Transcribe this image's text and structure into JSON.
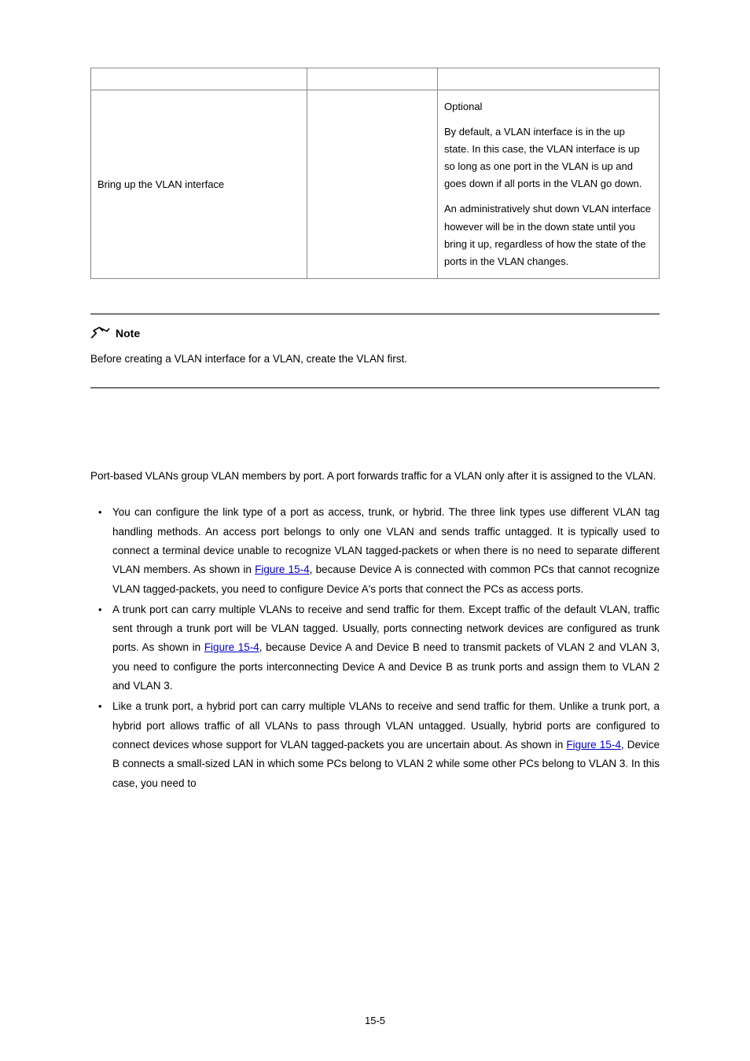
{
  "table": {
    "row1": {
      "c1": "Bring up the VLAN interface",
      "c2": "",
      "p1": "Optional",
      "p2": "By default, a VLAN interface is in the up state. In this case, the VLAN interface is up so long as one port in the VLAN is up and goes down if all ports in the VLAN go down.",
      "p3": "An administratively shut down VLAN interface however will be in the down state until you bring it up, regardless of how the state of the ports in the VLAN changes."
    }
  },
  "note": {
    "label": "Note",
    "text": "Before creating a VLAN interface for a VLAN, create the VLAN first."
  },
  "intro": "Port-based VLANs group VLAN members by port. A port forwards traffic for a VLAN only after it is assigned to the VLAN.",
  "b1a": "You can configure the link type of a port as access, trunk, or hybrid. The three link types use different VLAN tag handling methods. An access port belongs to only one VLAN and sends traffic untagged. It is typically used to connect a terminal device unable to recognize VLAN tagged-packets or when there is no need to separate different VLAN members. As shown in ",
  "b1link": "Figure 15-4",
  "b1b": ", because Device A is connected with common PCs that cannot recognize VLAN tagged-packets, you need to configure Device A's ports that connect the PCs as access ports.",
  "b2a": "A trunk port can carry multiple VLANs to receive and send traffic for them. Except traffic of the default VLAN, traffic sent through a trunk port will be VLAN tagged. Usually, ports connecting network devices are configured as trunk ports. As shown in ",
  "b2link": "Figure 15-4",
  "b2b": ", because Device A and Device B need to transmit packets of VLAN 2 and VLAN 3, you need to configure the ports interconnecting Device A and Device B as trunk ports and assign them to VLAN 2 and VLAN 3.",
  "b3a": "Like a trunk port, a hybrid port can carry multiple VLANs to receive and send traffic for them. Unlike a trunk port, a hybrid port allows traffic of all VLANs to pass through VLAN untagged. Usually, hybrid ports are configured to connect devices whose support for VLAN tagged-packets you are uncertain about. As shown in ",
  "b3link": "Figure 15-4",
  "b3b": ", Device B connects a small-sized LAN in which some PCs belong to VLAN 2 while some other PCs belong to VLAN 3. In this case, you need to",
  "pagenum": "15-5"
}
